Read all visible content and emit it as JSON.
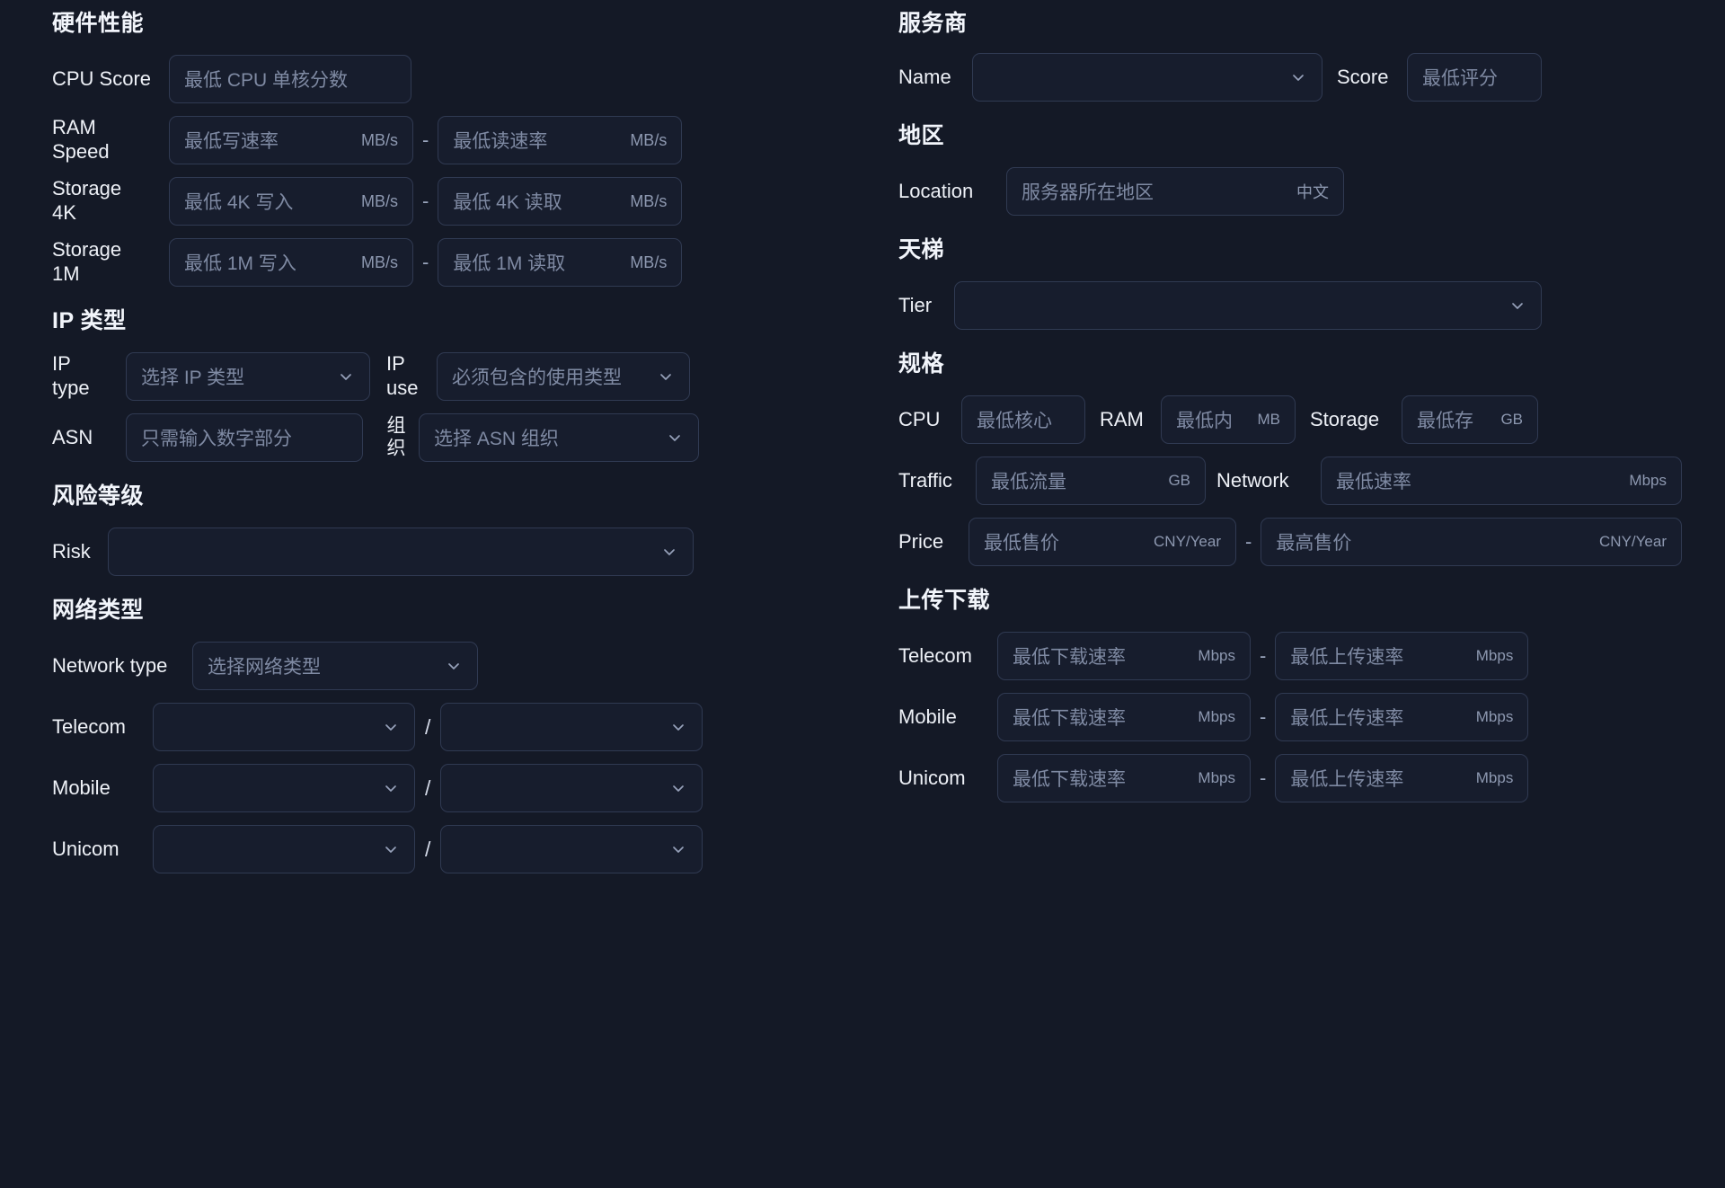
{
  "colors": {
    "background": "#141926",
    "field_fill": "#171d2d",
    "field_border": "#303a52",
    "text": "#eef1f7",
    "placeholder": "#7f8aa3",
    "unit": "#8d98b0"
  },
  "left": {
    "hardware": {
      "title": "硬件性能",
      "cpu_score": {
        "label": "CPU Score",
        "placeholder": "最低 CPU 单核分数"
      },
      "ram_speed": {
        "label": "RAM\nSpeed",
        "write_placeholder": "最低写速率",
        "write_unit": "MB/s",
        "separator": "-",
        "read_placeholder": "最低读速率",
        "read_unit": "MB/s"
      },
      "storage_4k": {
        "label": "Storage\n4K",
        "write_placeholder": "最低 4K 写入",
        "write_unit": "MB/s",
        "separator": "-",
        "read_placeholder": "最低 4K 读取",
        "read_unit": "MB/s"
      },
      "storage_1m": {
        "label": "Storage\n1M",
        "write_placeholder": "最低 1M 写入",
        "write_unit": "MB/s",
        "separator": "-",
        "read_placeholder": "最低 1M 读取",
        "read_unit": "MB/s"
      }
    },
    "ip_type": {
      "title": "IP 类型",
      "ip_type": {
        "label": "IP\ntype",
        "placeholder": "选择 IP 类型"
      },
      "ip_use": {
        "label": "IP\nuse",
        "placeholder": "必须包含的使用类型"
      },
      "asn": {
        "label": "ASN",
        "placeholder": "只需输入数字部分"
      },
      "asn_org": {
        "label": "组织",
        "placeholder": "选择 ASN 组织"
      }
    },
    "risk": {
      "title": "风险等级",
      "risk": {
        "label": "Risk",
        "value": ""
      }
    },
    "network": {
      "title": "网络类型",
      "network_type": {
        "label": "Network type",
        "placeholder": "选择网络类型"
      },
      "rows": [
        {
          "label": "Telecom",
          "left_value": "",
          "divider": "/",
          "right_value": ""
        },
        {
          "label": "Mobile",
          "left_value": "",
          "divider": "/",
          "right_value": ""
        },
        {
          "label": "Unicom",
          "left_value": "",
          "divider": "/",
          "right_value": ""
        }
      ]
    }
  },
  "right": {
    "provider": {
      "title": "服务商",
      "name": {
        "label": "Name",
        "value": ""
      },
      "score": {
        "label": "Score",
        "placeholder": "最低评分"
      }
    },
    "region": {
      "title": "地区",
      "location": {
        "label": "Location",
        "placeholder": "服务器所在地区",
        "unit": "中文"
      }
    },
    "tier": {
      "title": "天梯",
      "tier": {
        "label": "Tier",
        "value": ""
      }
    },
    "spec": {
      "title": "规格",
      "cpu": {
        "label": "CPU",
        "placeholder": "最低核心"
      },
      "ram": {
        "label": "RAM",
        "placeholder": "最低内",
        "unit": "MB"
      },
      "storage": {
        "label": "Storage",
        "placeholder": "最低存",
        "unit": "GB"
      },
      "traffic": {
        "label": "Traffic",
        "placeholder": "最低流量",
        "unit": "GB"
      },
      "network": {
        "label": "Network",
        "placeholder": "最低速率",
        "unit": "Mbps"
      },
      "price": {
        "label": "Price",
        "min_placeholder": "最低售价",
        "min_unit": "CNY/Year",
        "separator": "-",
        "max_placeholder": "最高售价",
        "max_unit": "CNY/Year"
      }
    },
    "updown": {
      "title": "上传下载",
      "rows": [
        {
          "label": "Telecom",
          "down_placeholder": "最低下载速率",
          "down_unit": "Mbps",
          "separator": "-",
          "up_placeholder": "最低上传速率",
          "up_unit": "Mbps"
        },
        {
          "label": "Mobile",
          "down_placeholder": "最低下载速率",
          "down_unit": "Mbps",
          "separator": "-",
          "up_placeholder": "最低上传速率",
          "up_unit": "Mbps"
        },
        {
          "label": "Unicom",
          "down_placeholder": "最低下载速率",
          "down_unit": "Mbps",
          "separator": "-",
          "up_placeholder": "最低上传速率",
          "up_unit": "Mbps"
        }
      ]
    }
  }
}
